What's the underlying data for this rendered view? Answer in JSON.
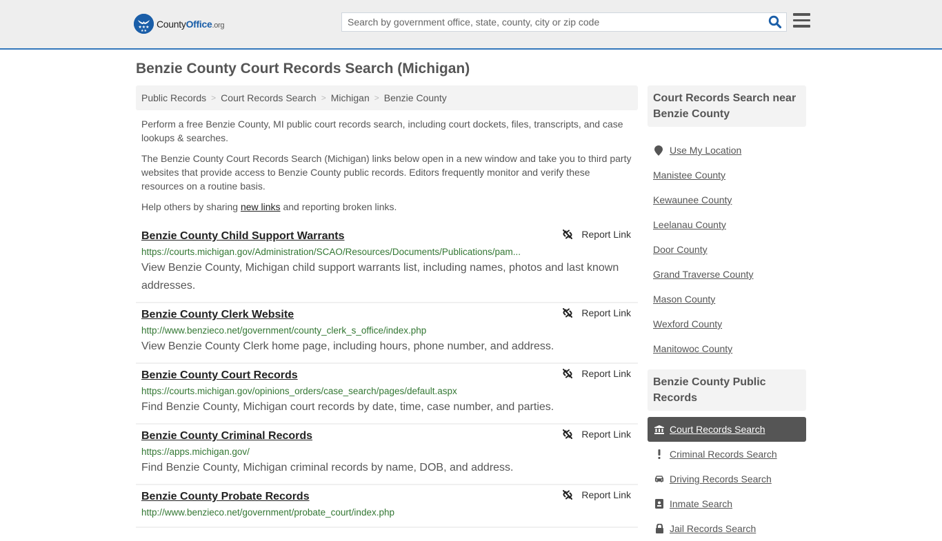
{
  "header": {
    "logo": {
      "county": "County",
      "office": "Office",
      "org": ".org"
    },
    "search_placeholder": "Search by government office, state, county, city or zip code",
    "search_value": "",
    "accent_color": "#3377bb"
  },
  "page_title": "Benzie County Court Records Search (Michigan)",
  "breadcrumb": [
    {
      "label": "Public Records"
    },
    {
      "label": "Court Records Search"
    },
    {
      "label": "Michigan"
    },
    {
      "label": "Benzie County"
    }
  ],
  "intro": {
    "p1": "Perform a free Benzie County, MI public court records search, including court dockets, files, transcripts, and case lookups & searches.",
    "p2": "The Benzie County Court Records Search (Michigan) links below open in a new window and take you to third party websites that provide access to Benzie County public records. Editors frequently monitor and verify these resources on a routine basis.",
    "p3_before": "Help others by sharing ",
    "p3_link": "new links",
    "p3_after": " and reporting broken links."
  },
  "report_label": "Report Link",
  "results": [
    {
      "title": "Benzie County Child Support Warrants",
      "url": "https://courts.michigan.gov/Administration/SCAO/Resources/Documents/Publications/pam...",
      "description": "View Benzie County, Michigan child support warrants list, including names, photos and last known addresses."
    },
    {
      "title": "Benzie County Clerk Website",
      "url": "http://www.benzieco.net/government/county_clerk_s_office/index.php",
      "description": "View Benzie County Clerk home page, including hours, phone number, and address."
    },
    {
      "title": "Benzie County Court Records",
      "url": "https://courts.michigan.gov/opinions_orders/case_search/pages/default.aspx",
      "description": "Find Benzie County, Michigan court records by date, time, case number, and parties."
    },
    {
      "title": "Benzie County Criminal Records",
      "url": "https://apps.michigan.gov/",
      "description": "Find Benzie County, Michigan criminal records by name, DOB, and address."
    },
    {
      "title": "Benzie County Probate Records",
      "url": "http://www.benzieco.net/government/probate_court/index.php",
      "description": ""
    }
  ],
  "sidebar": {
    "near_title": "Court Records Search near Benzie County",
    "use_location": "Use My Location",
    "near_items": [
      "Manistee County",
      "Kewaunee County",
      "Leelanau County",
      "Door County",
      "Grand Traverse County",
      "Mason County",
      "Wexford County",
      "Manitowoc County"
    ],
    "public_records_title": "Benzie County Public Records",
    "public_records": [
      {
        "label": "Court Records Search",
        "icon": "courthouse-icon",
        "active": true
      },
      {
        "label": "Criminal Records Search",
        "icon": "exclamation-icon",
        "active": false
      },
      {
        "label": "Driving Records Search",
        "icon": "car-icon",
        "active": false
      },
      {
        "label": "Inmate Search",
        "icon": "id-badge-icon",
        "active": false
      },
      {
        "label": "Jail Records Search",
        "icon": "lock-icon",
        "active": false
      }
    ]
  }
}
